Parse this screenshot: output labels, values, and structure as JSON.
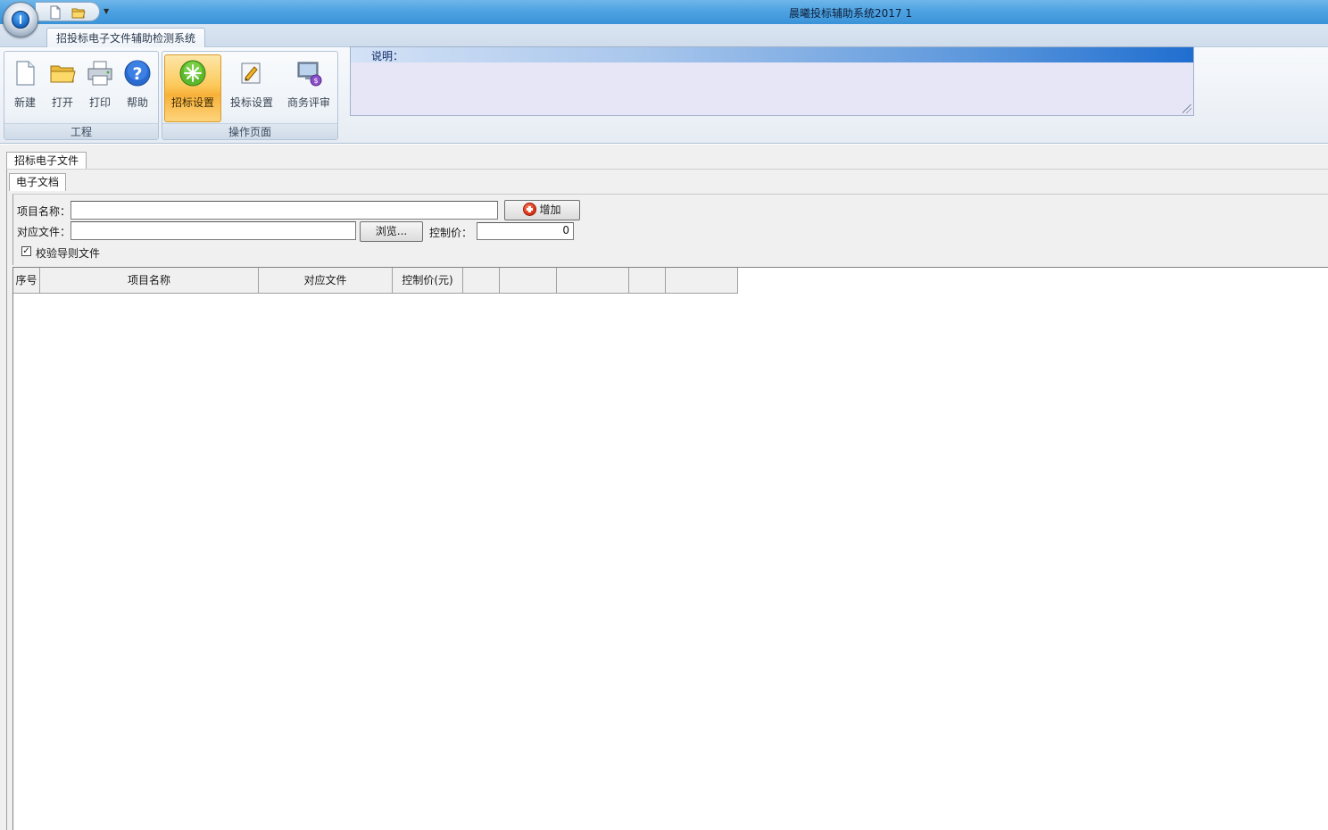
{
  "window": {
    "title": "晨曦投标辅助系统2017    1"
  },
  "ribbon": {
    "tab_label": "招投标电子文件辅助检测系统",
    "groups": [
      {
        "label": "工程",
        "buttons": [
          {
            "label": "新建",
            "icon": "new-document-icon"
          },
          {
            "label": "打开",
            "icon": "open-folder-icon"
          },
          {
            "label": "打印",
            "icon": "printer-icon"
          },
          {
            "label": "帮助",
            "icon": "help-icon"
          }
        ]
      },
      {
        "label": "操作页面",
        "buttons": [
          {
            "label": "招标设置",
            "icon": "tender-settings-icon",
            "active": true
          },
          {
            "label": "投标设置",
            "icon": "bid-settings-icon"
          },
          {
            "label": "商务评审",
            "icon": "business-review-icon"
          }
        ]
      }
    ]
  },
  "description": {
    "label": "说明："
  },
  "document_tab": "招标电子文件",
  "sub_tab": "电子文档",
  "form": {
    "project_name_label": "项目名称：",
    "project_name_value": "",
    "add_button": "增加",
    "file_label": "对应文件：",
    "file_value": "",
    "browse_button": "浏览...",
    "control_price_label": "控制价：",
    "control_price_value": "0",
    "validate_checkbox_label": "校验导则文件",
    "validate_checked": true
  },
  "grid": {
    "columns": [
      "序号",
      "项目名称",
      "对应文件",
      "控制价(元)",
      "",
      "",
      "",
      "",
      ""
    ],
    "rows": []
  },
  "colors": {
    "titlebar": "#4ea3e2",
    "active_button": "#f8b13a",
    "description_bg": "#e6e6f6"
  }
}
